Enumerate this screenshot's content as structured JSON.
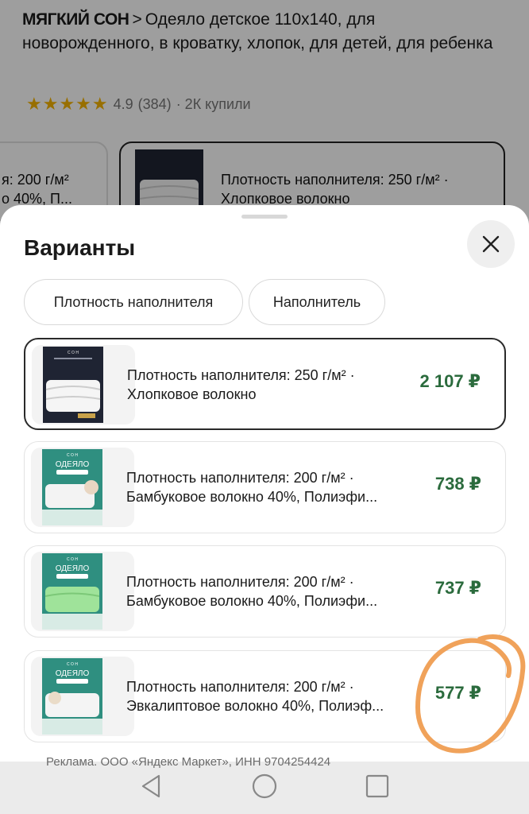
{
  "background": {
    "brand": "МЯГКИЙ СОН",
    "separator": ">",
    "product_title": "Одеяло детское 110x140, для новорожденного, в кроватку, хлопок, для детей, для ребенка",
    "stars": "★★★★★",
    "rating": "4.9",
    "reviews": "(384)",
    "purchases": "· 2К купили",
    "left_card_line1": "я: 200 г/м²",
    "left_card_line2": "о 40%, П...",
    "right_card_line1": "Плотность наполнителя: 250 г/м² ·",
    "right_card_line2": "Хлопковое волокно"
  },
  "sheet": {
    "title": "Варианты",
    "close_icon": "close-icon",
    "chips": [
      {
        "label": "Плотность наполнителя"
      },
      {
        "label": "Наполнитель"
      }
    ],
    "variants": [
      {
        "line1": "Плотность наполнителя: 250 г/м² ·",
        "line2": "Хлопковое волокно",
        "price": "2 107 ₽",
        "thumb": "dark"
      },
      {
        "line1": "Плотность наполнителя: 200 г/м² ·",
        "line2": "Бамбуковое волокно 40%, Полиэфи...",
        "price": "738 ₽",
        "thumb": "teal"
      },
      {
        "line1": "Плотность наполнителя: 200 г/м² ·",
        "line2": "Бамбуковое волокно 40%, Полиэфи...",
        "price": "737 ₽",
        "thumb": "teal-green"
      },
      {
        "line1": "Плотность наполнителя: 200 г/м² ·",
        "line2": "Эвкалиптовое волокно 40%, Полиэф...",
        "price": "577 ₽",
        "thumb": "teal"
      }
    ]
  },
  "footer": {
    "ad_text": "Реклама. ООО «Яндекс Маркет», ИНН 9704254424"
  },
  "colors": {
    "price_green": "#2b6b3d",
    "annotation_orange": "#f0a25a",
    "thumb_teal": "#2f8f80",
    "thumb_dark": "#1f2433"
  }
}
